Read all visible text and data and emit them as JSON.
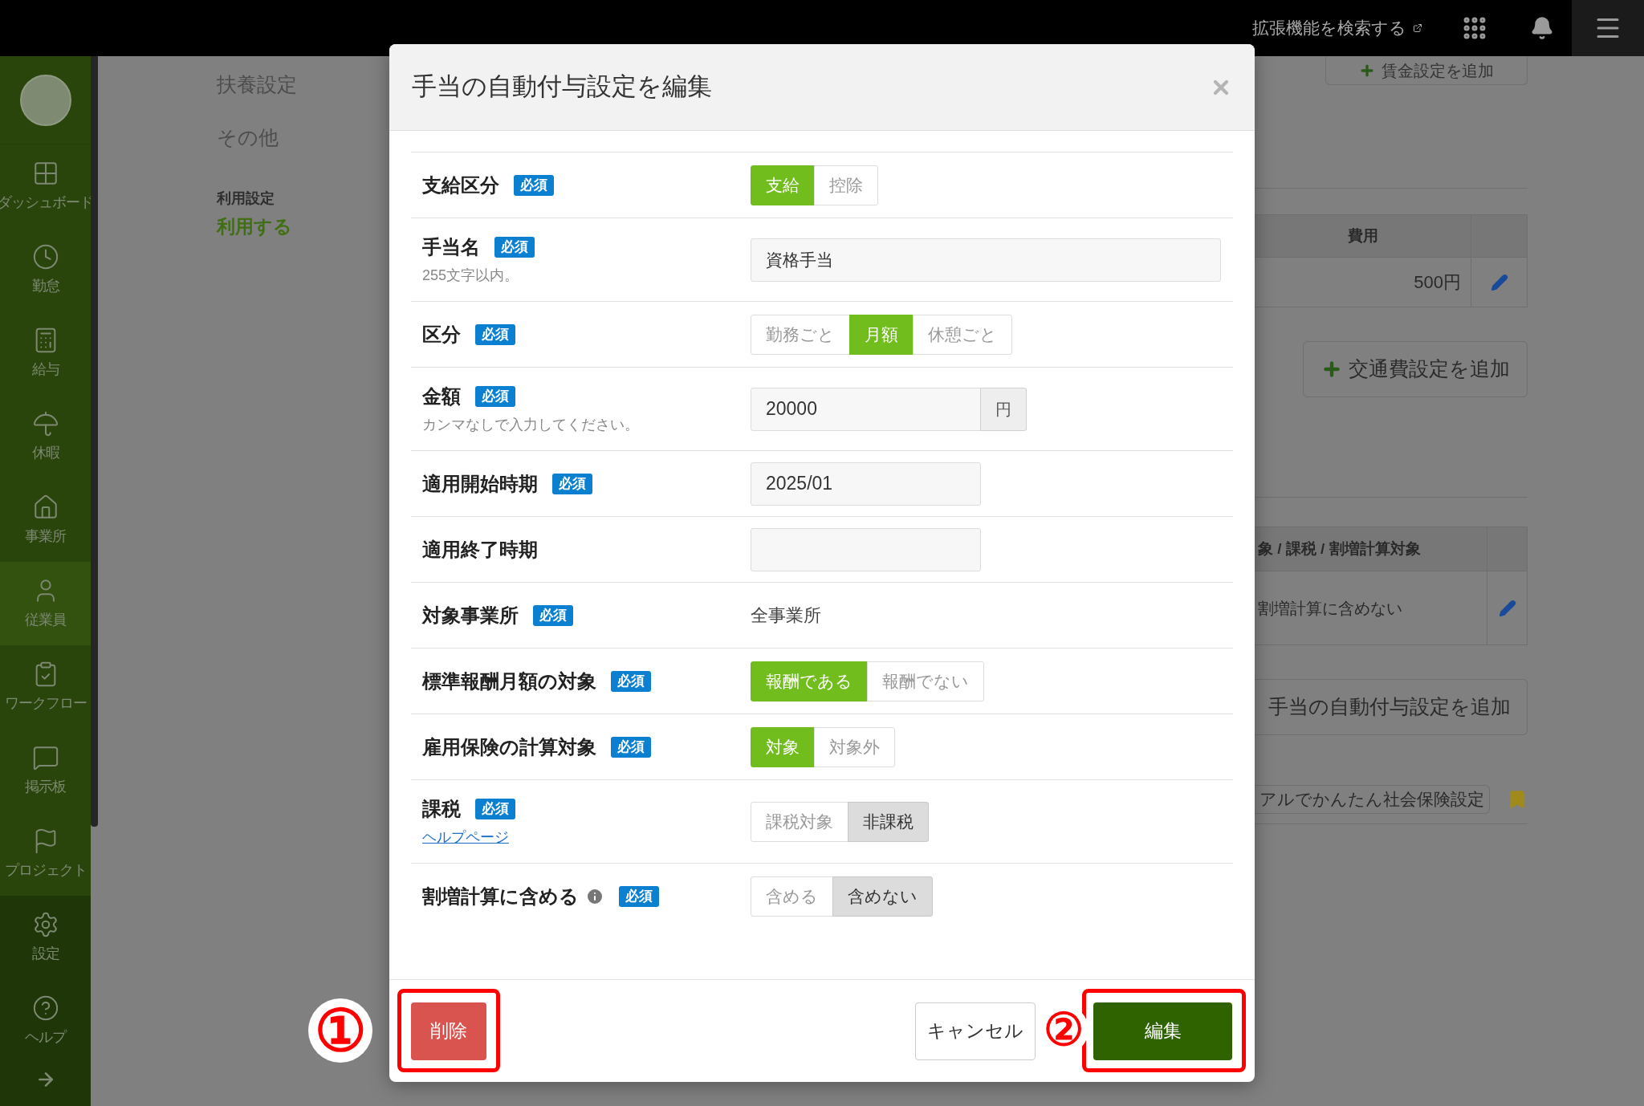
{
  "top_bar": {
    "search_link": "拡張機能を検索する"
  },
  "sidebar": {
    "items": [
      {
        "label": "ダッシュボード",
        "selected": false
      },
      {
        "label": "勤怠",
        "selected": false
      },
      {
        "label": "給与",
        "selected": false
      },
      {
        "label": "休暇",
        "selected": false
      },
      {
        "label": "事業所",
        "selected": false
      },
      {
        "label": "従業員",
        "selected": true
      },
      {
        "label": "ワークフロー",
        "selected": false
      },
      {
        "label": "掲示板",
        "selected": false
      },
      {
        "label": "プロジェクト",
        "selected": false
      },
      {
        "label": "設定",
        "selected": false
      },
      {
        "label": "ヘルプ",
        "selected": false
      }
    ]
  },
  "background": {
    "left": {
      "menu": [
        "扶養設定",
        "その他"
      ],
      "setting_label": "利用設定",
      "setting_value": "利用する"
    },
    "right": {
      "add_wage_button": "賃金設定を追加",
      "fee_table": {
        "columns": [
          "費用"
        ],
        "rows": [
          [
            "500円"
          ]
        ]
      },
      "add_commute_button": "交通費設定を追加",
      "allowance_table": {
        "columns": [
          "象 / 課税 / 割増計算対象"
        ],
        "rows": [
          [
            "割増計算に含めない"
          ]
        ]
      },
      "add_allowance_button": "手当の自動付与設定を追加",
      "insurance_button": "アルでかんたん社会保険設定"
    }
  },
  "modal": {
    "title": "手当の自動付与設定を編集",
    "fields": [
      {
        "kind": "toggle",
        "label": "支給区分",
        "badge": "必須",
        "options": [
          {
            "label": "支給",
            "selected": true
          },
          {
            "label": "控除",
            "selected": false
          }
        ]
      },
      {
        "kind": "text",
        "label": "手当名",
        "badge": "必須",
        "hint": "255文字以内。",
        "value": "資格手当"
      },
      {
        "kind": "toggle",
        "label": "区分",
        "badge": "必須",
        "options": [
          {
            "label": "勤務ごと",
            "selected": false
          },
          {
            "label": "月額",
            "selected": true
          },
          {
            "label": "休憩ごと",
            "selected": false
          }
        ]
      },
      {
        "kind": "amount",
        "label": "金額",
        "badge": "必須",
        "hint": "カンマなしで入力してください。",
        "value": "20000",
        "unit": "円"
      },
      {
        "kind": "date",
        "label": "適用開始時期",
        "badge": "必須",
        "value": "2025/01"
      },
      {
        "kind": "date",
        "label": "適用終了時期"
      },
      {
        "kind": "static",
        "label": "対象事業所",
        "badge": "必須",
        "value": "全事業所"
      },
      {
        "kind": "toggle",
        "label": "標準報酬月額の対象",
        "badge": "必須",
        "options": [
          {
            "label": "報酬である",
            "selected": true
          },
          {
            "label": "報酬でない",
            "selected": false
          }
        ]
      },
      {
        "kind": "toggle",
        "label": "雇用保険の計算対象",
        "badge": "必須",
        "options": [
          {
            "label": "対象",
            "selected": true
          },
          {
            "label": "対象外",
            "selected": false
          }
        ]
      },
      {
        "kind": "segment",
        "label": "課税",
        "badge": "必須",
        "link": "ヘルプページ",
        "options": [
          {
            "label": "課税対象",
            "selected": false
          },
          {
            "label": "非課税",
            "selected": true
          }
        ]
      },
      {
        "kind": "segment",
        "label": "割増計算に含める",
        "info": true,
        "badge": "必須",
        "options": [
          {
            "label": "含める",
            "selected": false
          },
          {
            "label": "含めない",
            "selected": true
          }
        ]
      }
    ],
    "footer": {
      "delete": "削除",
      "cancel": "キャンセル",
      "submit": "編集"
    }
  },
  "annotations": [
    {
      "label": "①"
    },
    {
      "label": "②"
    }
  ]
}
